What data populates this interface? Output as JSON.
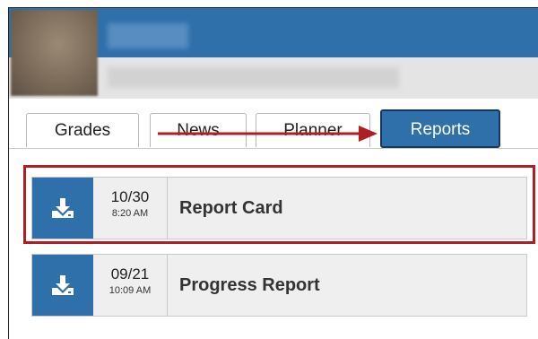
{
  "tabs": [
    {
      "label": "Grades"
    },
    {
      "label": "News"
    },
    {
      "label": "Planner"
    },
    {
      "label": "Reports"
    }
  ],
  "active_tab": "Reports",
  "reports": [
    {
      "date": "10/30",
      "time": "8:20 AM",
      "title": "Report Card",
      "highlighted": true
    },
    {
      "date": "09/21",
      "time": "10:09 AM",
      "title": "Progress Report",
      "highlighted": false
    }
  ],
  "icons": {
    "download": "download-icon",
    "annotation_arrow": "arrow-right-icon"
  },
  "colors": {
    "brand_blue": "#2f6faa",
    "annotation_red": "#b01e23",
    "row_bg": "#efefef"
  }
}
